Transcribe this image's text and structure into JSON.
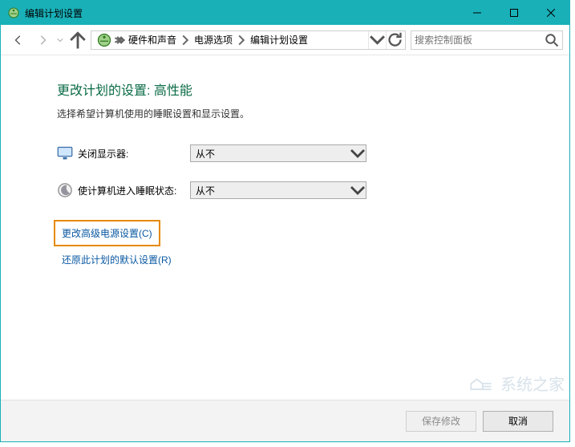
{
  "window": {
    "title": "编辑计划设置"
  },
  "breadcrumb": {
    "items": [
      "硬件和声音",
      "电源选项",
      "编辑计划设置"
    ]
  },
  "search": {
    "placeholder": "搜索控制面板"
  },
  "page": {
    "heading": "更改计划的设置: 高性能",
    "subheading": "选择希望计算机使用的睡眠设置和显示设置。"
  },
  "settings": {
    "display": {
      "label": "关闭显示器:",
      "value": "从不"
    },
    "sleep": {
      "label": "使计算机进入睡眠状态:",
      "value": "从不"
    }
  },
  "links": {
    "advanced": "更改高级电源设置(C)",
    "restore": "还原此计划的默认设置(R)"
  },
  "footer": {
    "save": "保存修改",
    "cancel": "取消"
  },
  "watermark": "系统之家"
}
